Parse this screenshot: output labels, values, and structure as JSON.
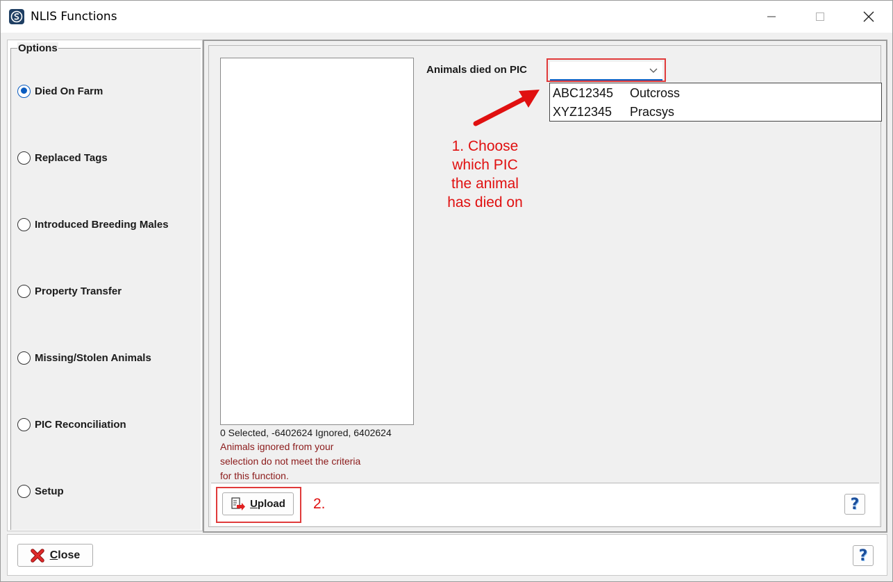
{
  "window": {
    "title": "NLIS Functions"
  },
  "options": {
    "legend": "Options",
    "items": [
      {
        "label": "Died On Farm",
        "checked": true
      },
      {
        "label": "Replaced Tags",
        "checked": false
      },
      {
        "label": "Introduced Breeding Males",
        "checked": false
      },
      {
        "label": "Property Transfer",
        "checked": false
      },
      {
        "label": "Missing/Stolen Animals",
        "checked": false
      },
      {
        "label": "PIC Reconciliation",
        "checked": false
      },
      {
        "label": "Setup",
        "checked": false
      }
    ]
  },
  "main": {
    "selection_status": "0 Selected, -6402624 Ignored, 6402624",
    "ignored_note_lines": [
      "Animals ignored from your",
      "selection do not meet the criteria",
      "for this function."
    ],
    "pic_label": "Animals died on PIC",
    "pic_value": "",
    "pic_options": [
      {
        "code": "ABC12345",
        "name": "Outcross"
      },
      {
        "code": "XYZ12345",
        "name": "Pracsys"
      }
    ],
    "annotation_1_lines": [
      "1. Choose",
      "which PIC",
      "the animal",
      "has died on"
    ],
    "upload_label_first": "U",
    "upload_label_rest": "pload",
    "annotation_2": "2.",
    "help_label": "?"
  },
  "footer": {
    "close_label_first": "C",
    "close_label_rest": "lose",
    "help_label": "?"
  },
  "colors": {
    "annotation": "#e01010",
    "accent": "#0a5cc0",
    "warning_text": "#8b1a1a"
  },
  "icons": {
    "app": "app-logo-icon",
    "caret": "chevron-down-icon",
    "upload": "upload-document-icon",
    "close": "red-x-icon",
    "help": "question-mark-icon"
  }
}
